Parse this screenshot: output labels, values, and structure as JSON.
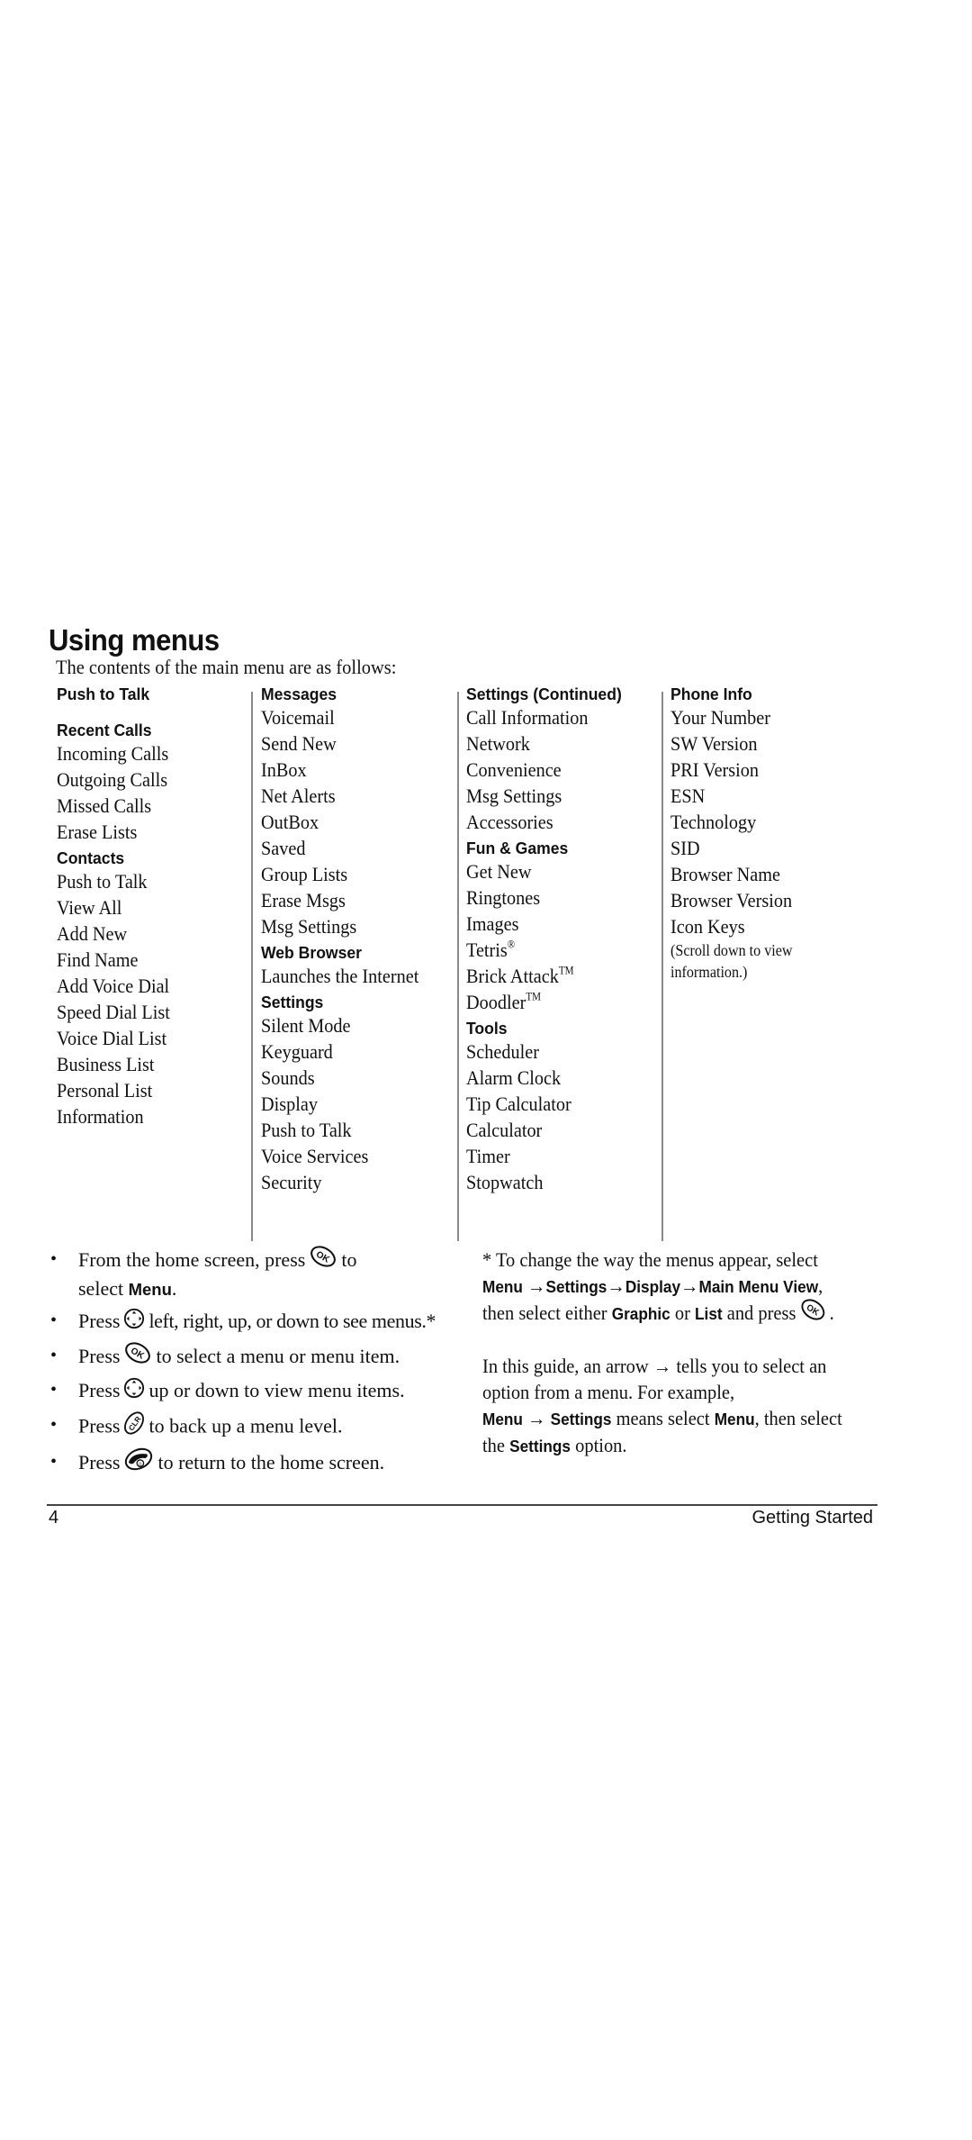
{
  "title": "Using menus",
  "intro": "The contents of the main menu are as follows:",
  "columns": [
    {
      "groups": [
        {
          "heading": "Push to Talk",
          "items": []
        },
        {
          "heading": "Recent Calls",
          "items": [
            "Incoming Calls",
            "Outgoing Calls",
            "Missed Calls",
            "Erase Lists"
          ]
        },
        {
          "heading": "Contacts",
          "items": [
            "Push to Talk",
            "View All",
            "Add New",
            "Find Name",
            "Add Voice Dial",
            "Speed Dial List",
            "Voice Dial List",
            "Business List",
            "Personal List",
            "Information"
          ]
        }
      ]
    },
    {
      "groups": [
        {
          "heading": "Messages",
          "items": [
            "Voicemail",
            "Send New",
            "InBox",
            "Net Alerts",
            "OutBox",
            "Saved",
            "Group Lists",
            "Erase Msgs",
            "Msg Settings"
          ]
        },
        {
          "heading": "Web Browser",
          "items": [
            "Launches the Internet"
          ]
        },
        {
          "heading": "Settings",
          "items": [
            "Silent Mode",
            "Keyguard",
            "Sounds",
            "Display",
            "Push to Talk",
            "Voice Services",
            "Security"
          ]
        }
      ]
    },
    {
      "groups": [
        {
          "heading": "Settings (Continued)",
          "items": [
            "Call Information",
            "Network",
            "Convenience",
            "Msg Settings",
            "Accessories"
          ]
        },
        {
          "heading": "Fun & Games",
          "items": [
            "Get New",
            "Ringtones",
            "Images",
            "Tetris",
            "Brick Attack",
            "Doodler"
          ]
        },
        {
          "heading": "Tools",
          "items": [
            "Scheduler",
            "Alarm Clock",
            "Tip Calculator",
            "Calculator",
            "Timer",
            "Stopwatch"
          ]
        }
      ]
    },
    {
      "groups": [
        {
          "heading": "Phone Info",
          "items": [
            "Your Number",
            "SW Version",
            "PRI Version",
            "ESN",
            "Technology",
            "SID",
            "Browser Name",
            "Browser Version",
            "Icon Keys"
          ]
        }
      ],
      "note": [
        "(Scroll down to view",
        "information.)"
      ]
    }
  ],
  "marks": {
    "registered": "®",
    "trademark": "TM"
  },
  "bullets": [
    {
      "pre": "From the home screen, press",
      "icon": "ok-key-icon",
      "post": "to",
      "line2_pre": "select ",
      "line2_bold": "Menu",
      "line2_post": "."
    },
    {
      "pre": "Press",
      "icon": "nav-key-icon",
      "post": "left, right, up, or down to see menus.*"
    },
    {
      "pre": "Press",
      "icon": "ok-key-icon",
      "post": "to select a menu or menu item."
    },
    {
      "pre": "Press",
      "icon": "nav-key-icon",
      "post": "up or down to view menu items."
    },
    {
      "pre": "Press",
      "icon": "clr-key-icon",
      "post": "to back up a menu level."
    },
    {
      "pre": "Press",
      "icon": "end-key-icon",
      "post": "to return to the home screen."
    }
  ],
  "note_menus": {
    "line1": "* To change the way the menus appear, select",
    "path": [
      "Menu",
      "Settings",
      "Display",
      "Main Menu View"
    ],
    "path_end": ",",
    "line3_pre": "then select either ",
    "opt1": "Graphic",
    "or": " or ",
    "opt2": "List",
    "line3_post": " and press",
    "line3_end": "."
  },
  "note_arrow": {
    "line1": "In this guide, an arrow → tells you to select an",
    "line2": "option from a menu. For example,",
    "line3_b1": "Menu",
    "line3_arrow": " → ",
    "line3_b2": "Settings",
    "line3_mid": " means select ",
    "line3_b3": "Menu",
    "line3_post": ", then select",
    "line4_pre": "the ",
    "line4_b": "Settings",
    "line4_post": " option."
  },
  "arrow": "→",
  "bullet_char": "•",
  "footer": {
    "page_number": "4",
    "section": "Getting Started"
  }
}
